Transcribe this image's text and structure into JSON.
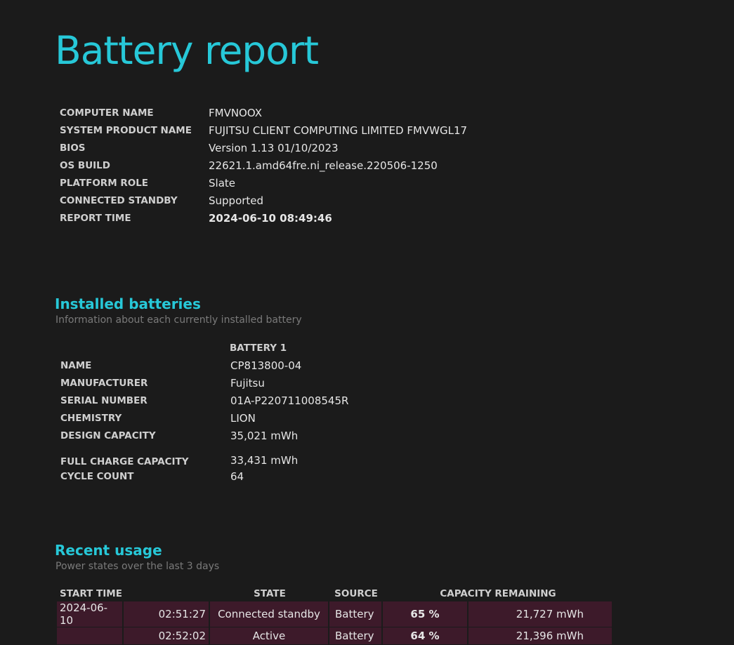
{
  "title": "Battery report",
  "system_info": [
    {
      "label": "COMPUTER NAME",
      "value": "FMVNOOX"
    },
    {
      "label": "SYSTEM PRODUCT NAME",
      "value": "FUJITSU CLIENT COMPUTING LIMITED FMVWGL17"
    },
    {
      "label": "BIOS",
      "value": "Version 1.13 01/10/2023"
    },
    {
      "label": "OS BUILD",
      "value": "22621.1.amd64fre.ni_release.220506-1250"
    },
    {
      "label": "PLATFORM ROLE",
      "value": "Slate"
    },
    {
      "label": "CONNECTED STANDBY",
      "value": "Supported"
    },
    {
      "label": "REPORT TIME",
      "value": "2024-06-10  08:49:46"
    }
  ],
  "installed_batteries": {
    "title": "Installed batteries",
    "subtitle": "Information about each currently installed battery",
    "column": "BATTERY 1",
    "rows": [
      {
        "label": "NAME",
        "value": "CP813800-04"
      },
      {
        "label": "MANUFACTURER",
        "value": "Fujitsu"
      },
      {
        "label": "SERIAL NUMBER",
        "value": "01A-P220711008545R"
      },
      {
        "label": "CHEMISTRY",
        "value": "LION"
      },
      {
        "label": "DESIGN CAPACITY",
        "value": "35,021 mWh"
      },
      {
        "label": "FULL CHARGE CAPACITY",
        "value": "33,431 mWh"
      },
      {
        "label": "CYCLE COUNT",
        "value": "64"
      }
    ]
  },
  "recent_usage": {
    "title": "Recent usage",
    "subtitle": "Power states over the last 3 days",
    "headers": {
      "start_time": "START TIME",
      "state": "STATE",
      "source": "SOURCE",
      "capacity": "CAPACITY REMAINING"
    },
    "rows": [
      {
        "date": "2024-06-10",
        "time": "02:51:27",
        "state": "Connected standby",
        "source": "Battery",
        "percent": "65 %",
        "mwh": "21,727 mWh"
      },
      {
        "date": "",
        "time": "02:52:02",
        "state": "Active",
        "source": "Battery",
        "percent": "64 %",
        "mwh": "21,396 mWh"
      }
    ]
  },
  "colors": {
    "accent": "#27c8d8",
    "row_bg": "#3d1a2a",
    "background": "#1b1b1b"
  }
}
